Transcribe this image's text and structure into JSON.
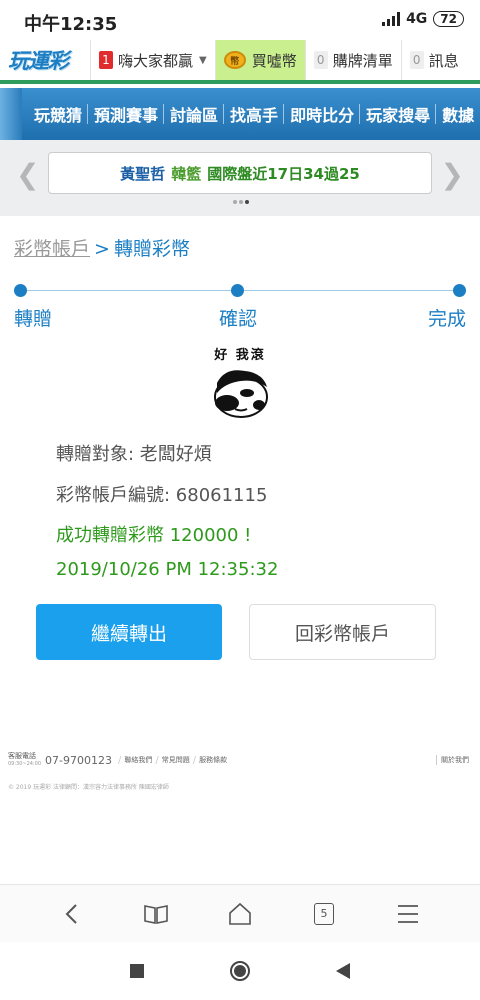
{
  "status": {
    "time": "中午12:35",
    "network": "4G",
    "battery": "72"
  },
  "topnav": {
    "logo": "玩運彩",
    "items": [
      {
        "badge": "1",
        "label": "嗨大家都贏"
      },
      {
        "label": "買噓幣"
      },
      {
        "badge": "0",
        "label": "購牌清單"
      },
      {
        "badge": "0",
        "label": "訊息"
      }
    ]
  },
  "menu": {
    "items": [
      "玩競猜",
      "預測賽事",
      "討論區",
      "找高手",
      "即時比分",
      "玩家搜尋",
      "數據"
    ]
  },
  "ticker": {
    "name": "黃聖哲",
    "team": "韓籃",
    "stat": "國際盤近17日34過25"
  },
  "breadcrumb": {
    "parent": "彩幣帳戶",
    "sep": ">",
    "current": "轉贈彩幣"
  },
  "steps": [
    "轉贈",
    "確認",
    "完成"
  ],
  "meme": {
    "text": "好 我滾"
  },
  "result": {
    "target": "轉贈對象: 老闆好煩",
    "account": "彩幣帳戶編號: 68061115",
    "success": "成功轉贈彩幣 120000 !",
    "datetime": "2019/10/26 PM 12:35:32"
  },
  "buttons": {
    "continue": "繼續轉出",
    "back": "回彩幣帳戶"
  },
  "footer": {
    "service_label": "客服電話",
    "service_hours": "09:30~24:00",
    "phone": "07-9700123",
    "links": [
      "聯絡我們",
      "常見問題",
      "服務條款"
    ],
    "right_link": "關於我們",
    "copyright": "© 2019 玩運彩 法律顧問：漢宗容力法律事務所 陳國宏律師"
  },
  "browser": {
    "tab_count": "5"
  }
}
